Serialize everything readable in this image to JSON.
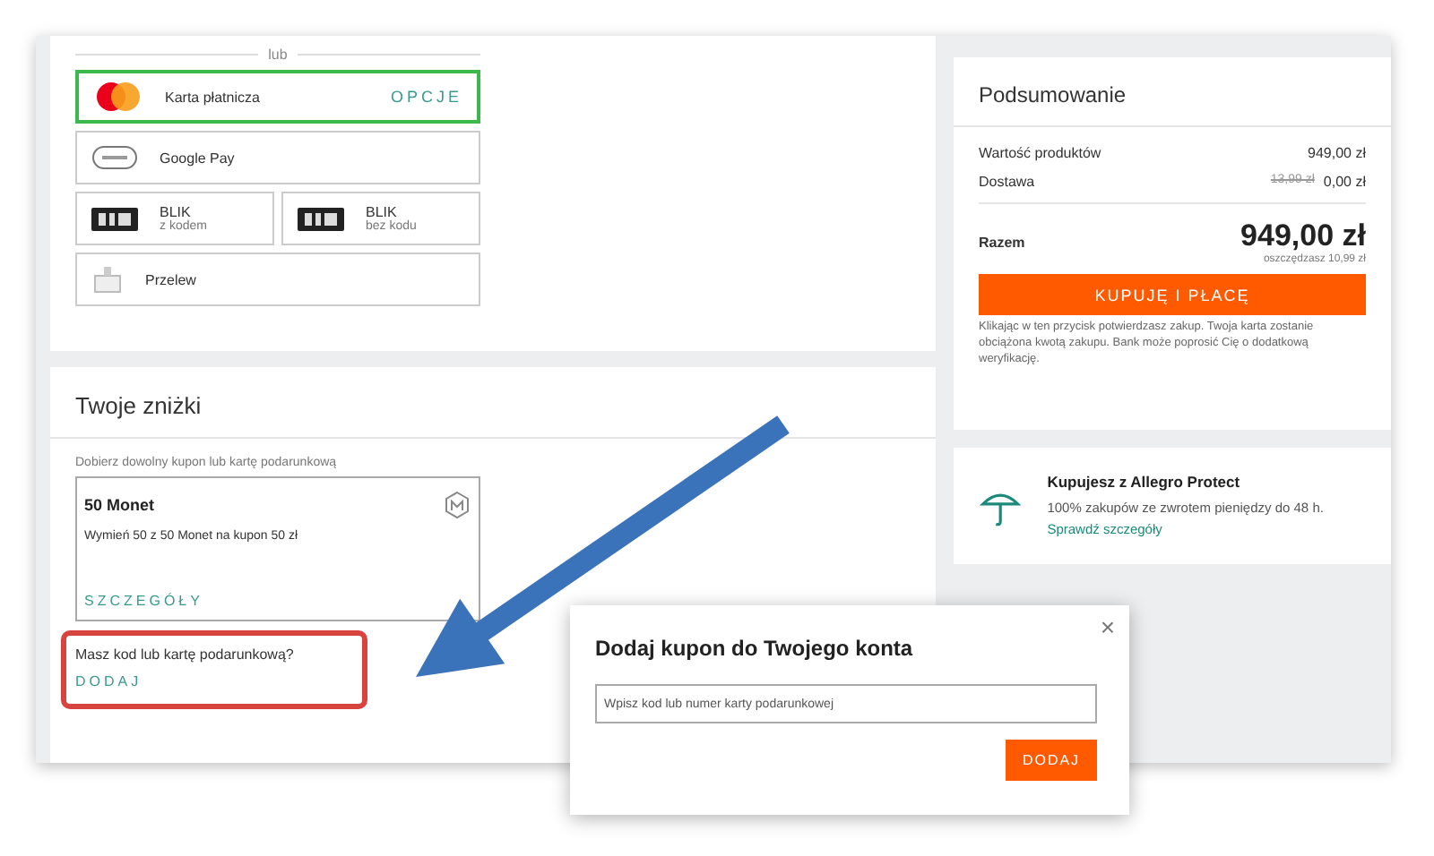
{
  "payment": {
    "divider_label": "lub",
    "rows": [
      [
        {
          "kind": "card",
          "label": "Karta płatnicza",
          "action": "OPCJE",
          "selected": true
        }
      ],
      [
        {
          "kind": "gpay",
          "label": "Google Pay",
          "selected": false
        }
      ],
      [
        {
          "kind": "blik",
          "label": "BLIK",
          "sublabel": "z kodem",
          "selected": false
        },
        {
          "kind": "blik",
          "label": "BLIK",
          "sublabel": "bez kodu",
          "selected": false
        }
      ],
      [
        {
          "kind": "transfer",
          "label": "Przelew",
          "selected": false
        }
      ]
    ]
  },
  "discounts": {
    "title": "Twoje zniżki",
    "hint": "Dobierz dowolny kupon lub kartę podarunkową",
    "coupon": {
      "title": "50 Monet",
      "text": "Wymień 50 z 50 Monet na kupon 50 zł",
      "link": "SZCZEGÓŁY"
    },
    "code_question": "Masz kod lub kartę podarunkową?",
    "code_link": "DODAJ"
  },
  "summary": {
    "title": "Podsumowanie",
    "rows": [
      {
        "label": "Wartość produktów",
        "value": "949,00 zł"
      },
      {
        "label": "Dostawa",
        "old": "13,99 zł",
        "value": "0,00 zł"
      }
    ],
    "total_label": "Razem",
    "total": "949,00 zł",
    "savings": "oszczędzasz 10,99 zł",
    "buy_button": "KUPUJĘ I PŁACĘ",
    "note": "Klikając w ten przycisk potwierdzasz zakup. Twoja karta zostanie obciążona kwotą zakupu. Bank może poprosić Cię o dodatkową weryfikację."
  },
  "protect": {
    "title": "Kupujesz z Allegro Protect",
    "text": "100% zakupów ze zwrotem pieniędzy do 48 h.",
    "link": "Sprawdź szczegóły"
  },
  "dialog": {
    "title": "Dodaj kupon do Twojego konta",
    "placeholder": "Wpisz kod lub numer karty podarunkowej",
    "button": "DODAJ",
    "close": "×"
  }
}
